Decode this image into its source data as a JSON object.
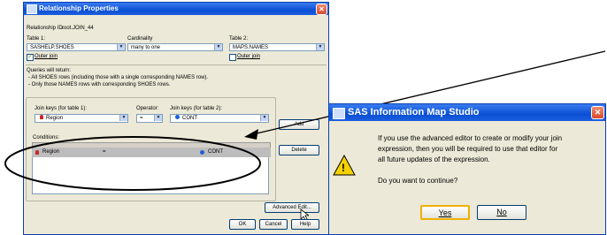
{
  "rel_dialog": {
    "title": "Relationship Properties",
    "close_glyph": "✕",
    "relationship_id_label": "Relationship ID:",
    "relationship_id_value": "root.JOIN_44",
    "table1_label": "Table 1:",
    "table1_value": "SASHELP.SHOES",
    "cardinality_label": "Cardinality",
    "cardinality_value": "many to one",
    "table2_label": "Table 2:",
    "table2_value": "MAPS.NAMES",
    "outer_join_1": "Outer join",
    "outer_join_1_checked": true,
    "outer_join_2": "Outer join",
    "outer_join_2_checked": false,
    "queries_heading": "Queries will return:",
    "query_line_1": "- All SHOES rows (including those with a single corresponding NAMES row).",
    "query_line_2": "- Only those NAMES rows with corresponding SHOES rows.",
    "join_keys_1_label": "Join keys (for table 1):",
    "operator_label": "Operator:",
    "join_keys_2_label": "Join keys (for table 2):",
    "key1_value": "Region",
    "operator_value": "=",
    "key2_value": "CONT",
    "add_button": "Add",
    "conditions_label": "Conditions:",
    "condition_row": {
      "left": "Region",
      "op": "=",
      "right": "CONT"
    },
    "delete_button": "Delete",
    "advanced_button": "Advanced Edit...",
    "ok_button": "OK",
    "cancel_button": "Cancel",
    "help_button": "Help"
  },
  "msg_dialog": {
    "title": "SAS Information Map Studio",
    "close_glyph": "✕",
    "message_1": "If you use the advanced editor to create or modify your join",
    "message_2": "expression, then you will be required to use that editor for",
    "message_3": "all future updates of the expression.",
    "question": "Do you want to continue?",
    "yes_button": "Yes",
    "no_button": "No",
    "warning_glyph": "!"
  },
  "colors": {
    "title_blue": "#0a4fd3",
    "dialog_bg": "#ece9d8",
    "warning_yellow": "#f5d200",
    "key_red": "#c62828",
    "key_blue": "#1e5fd8"
  }
}
